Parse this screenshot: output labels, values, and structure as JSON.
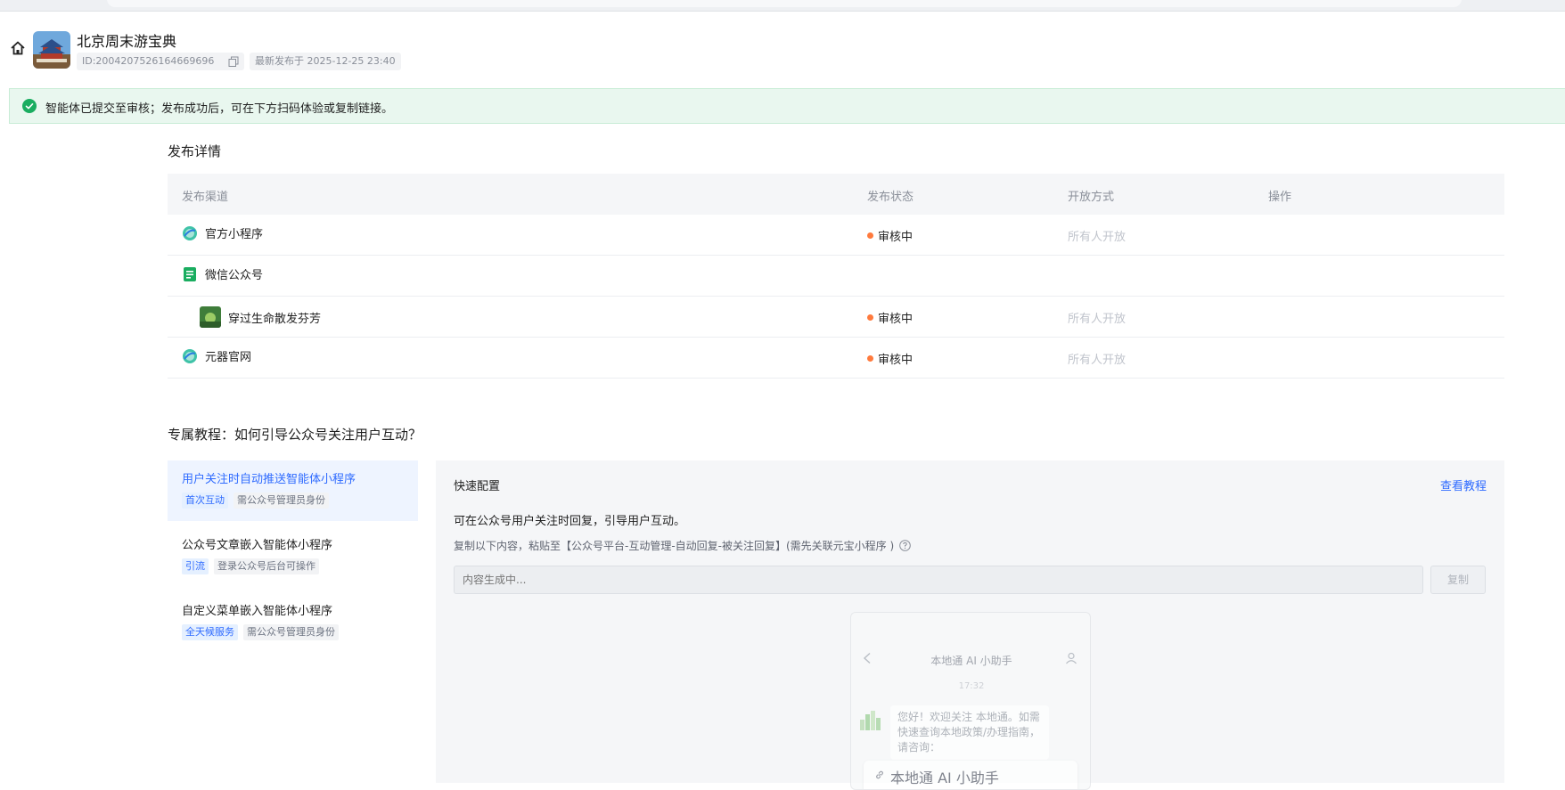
{
  "agent": {
    "title": "北京周末游宝典",
    "id_text": "ID:2004207526164669696",
    "published_text": "最新发布于 2025-12-25 23:40"
  },
  "banner": {
    "message": "智能体已提交至审核；发布成功后，可在下方扫码体验或复制链接。"
  },
  "publish": {
    "section_title": "发布详情",
    "columns": [
      "发布渠道",
      "发布状态",
      "开放方式",
      "操作"
    ],
    "rows": [
      {
        "channel": "官方小程序",
        "icon": "globe-icon",
        "status": "审核中",
        "open": "所有人开放"
      },
      {
        "channel": "微信公众号",
        "icon": "wechat-doc-icon",
        "status": "",
        "open": ""
      },
      {
        "channel": "穿过生命散发芬芳",
        "icon": "account-thumbnail",
        "status": "审核中",
        "open": "所有人开放"
      },
      {
        "channel": "元器官网",
        "icon": "globe-icon",
        "status": "审核中",
        "open": "所有人开放"
      }
    ]
  },
  "tutorial": {
    "section_title": "专属教程：如何引导公众号关注用户互动？",
    "items": [
      {
        "title": "用户关注时自动推送智能体小程序",
        "tags": [
          "首次互动",
          "需公众号管理员身份"
        ]
      },
      {
        "title": "公众号文章嵌入智能体小程序",
        "tags": [
          "引流",
          "登录公众号后台可操作"
        ]
      },
      {
        "title": "自定义菜单嵌入智能体小程序",
        "tags": [
          "全天候服务",
          "需公众号管理员身份"
        ]
      }
    ],
    "panel": {
      "title": "快速配置",
      "view_link": "查看教程",
      "desc": "可在公众号用户关注时回复，引导用户互动。",
      "hint": "复制以下内容，粘贴至【公众号平台-互动管理-自动回复-被关注回复】(需先关联元宝小程序 )",
      "input_placeholder": "内容生成中...",
      "copy_label": "复制",
      "preview": {
        "title": "本地通 AI 小助手",
        "time": "17:32",
        "bubble": "您好！欢迎关注 本地通。如需快速查询本地政策/办理指南，请咨询：",
        "card_title": "本地通 AI 小助手"
      }
    }
  },
  "colors": {
    "accent": "#2f6bff",
    "success": "#1aad60",
    "pending_dot": "#ff7a3d",
    "banner_bg": "#e9f7ef"
  }
}
